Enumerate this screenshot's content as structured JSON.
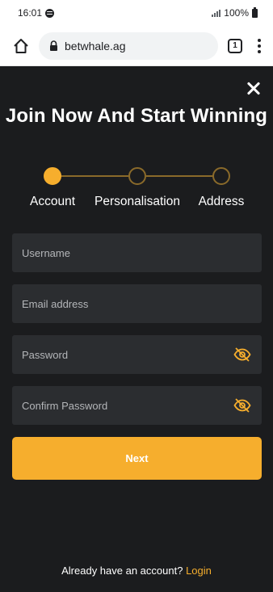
{
  "status_bar": {
    "time": "16:01",
    "battery": "100%"
  },
  "browser": {
    "url": "betwhale.ag",
    "tab_count": "1"
  },
  "page": {
    "title": "Join Now And Start Winning",
    "steps": [
      {
        "label": "Account",
        "active": true
      },
      {
        "label": "Personalisation",
        "active": false
      },
      {
        "label": "Address",
        "active": false
      }
    ],
    "fields": {
      "username": {
        "placeholder": "Username"
      },
      "email": {
        "placeholder": "Email address"
      },
      "password": {
        "placeholder": "Password"
      },
      "confirm_password": {
        "placeholder": "Confirm Password"
      }
    },
    "next_label": "Next",
    "footer_text": "Already have an account?",
    "login_label": "Login"
  },
  "colors": {
    "accent": "#f6ae2d",
    "background": "#1b1c1e",
    "field": "#2b2d30"
  }
}
